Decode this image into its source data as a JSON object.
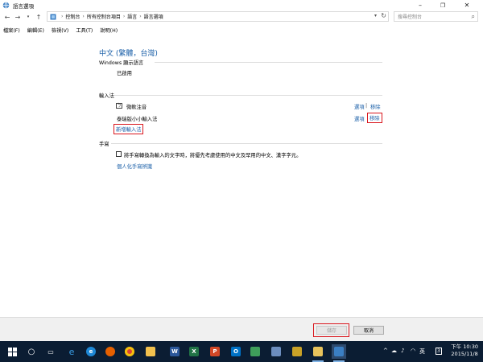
{
  "window": {
    "title": "語言選項"
  },
  "address": {
    "breadcrumbs": [
      "控制台",
      "所有控制台項目",
      "語言",
      "語言選項"
    ],
    "search_placeholder": "搜尋控制台"
  },
  "menu": [
    "檔案(F)",
    "編輯(E)",
    "檢視(V)",
    "工具(T)",
    "說明(H)"
  ],
  "language": {
    "title": "中文 (繁體，台灣)",
    "display_section": "Windows 顯示語言",
    "display_status": "已啟用",
    "ime_section": "輸入法",
    "imes": [
      {
        "name": "微軟注音",
        "options": "選項",
        "remove": "移除",
        "sep": "|"
      },
      {
        "name": "泰瑞版小小輸入法",
        "options": "選項",
        "remove": "移除"
      }
    ],
    "add_ime": "新增輸入法",
    "handwriting_section": "手寫",
    "handwriting_checkbox": "將手寫轉換為輸入的文字時，將優先考慮使用的中文及罕用的中文、漢字字元。",
    "personalize_link": "個人化手寫辨識"
  },
  "footer": {
    "save": "儲存",
    "cancel": "取消"
  },
  "taskbar": {
    "clock_time": "下午 10:30",
    "clock_date": "2015/11/8",
    "notification_badge": "3"
  },
  "colors": {
    "link": "#1a5fa8",
    "highlight": "#d9161d",
    "taskbar": "#0b1d33"
  }
}
